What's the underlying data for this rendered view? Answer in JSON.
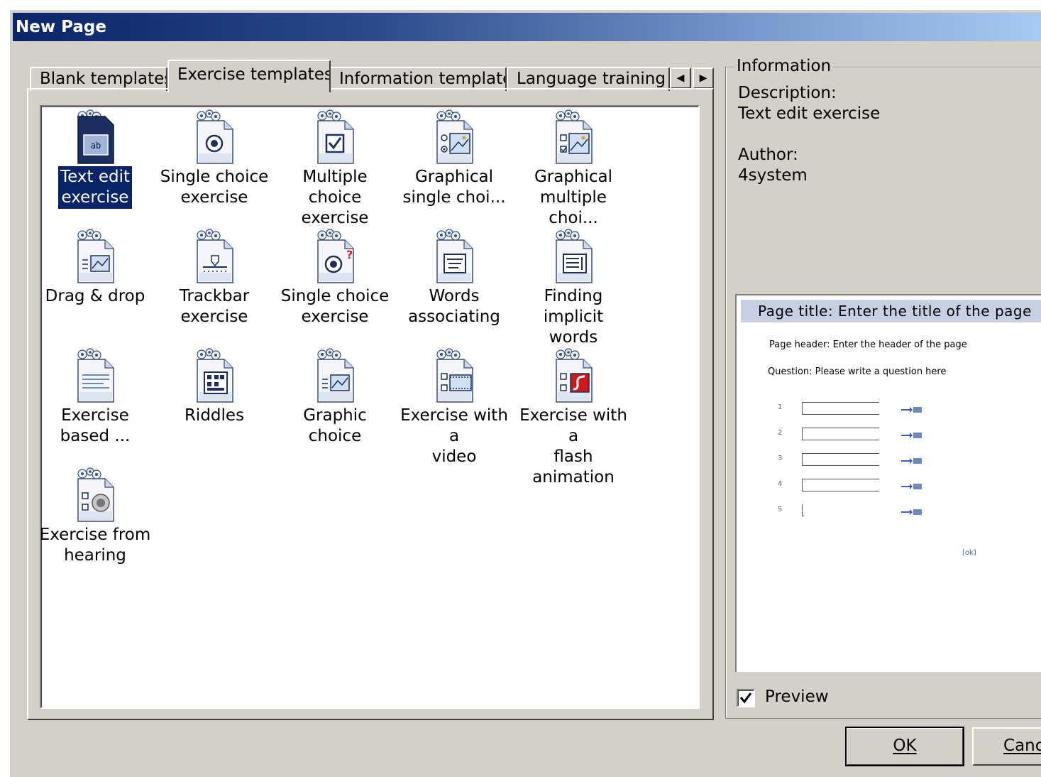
{
  "window": {
    "title": "New Page"
  },
  "tabs": [
    {
      "label": "Blank templates",
      "active": false
    },
    {
      "label": "Exercise templates",
      "active": true
    },
    {
      "label": "Information templates",
      "active": false
    },
    {
      "label": "Language training t",
      "active": false
    }
  ],
  "tab_scroll": {
    "left": "◀",
    "right": "▶"
  },
  "templates": [
    {
      "label": "Text edit\nexercise",
      "icon": "text-edit-icon",
      "selected": true
    },
    {
      "label": "Single choice\nexercise",
      "icon": "radio-icon"
    },
    {
      "label": "Multiple choice\nexercise",
      "icon": "checkbox-icon"
    },
    {
      "label": "Graphical\nsingle choi...",
      "icon": "graphical-single-icon"
    },
    {
      "label": "Graphical\nmultiple choi...",
      "icon": "graphical-multiple-icon"
    },
    {
      "label": "Drag & drop",
      "icon": "drag-drop-icon"
    },
    {
      "label": "Trackbar\nexercise",
      "icon": "trackbar-icon"
    },
    {
      "label": "Single choice\nexercise",
      "icon": "radio-question-icon"
    },
    {
      "label": "Words\nassociating",
      "icon": "words-associating-icon"
    },
    {
      "label": "Finding implicit\nwords",
      "icon": "implicit-words-icon"
    },
    {
      "label": "Exercise\nbased ...",
      "icon": "text-lines-icon"
    },
    {
      "label": "Riddles",
      "icon": "riddles-icon"
    },
    {
      "label": "Graphic\nchoice",
      "icon": "graphic-choice-icon"
    },
    {
      "label": "Exercise with a\nvideo",
      "icon": "video-icon"
    },
    {
      "label": "Exercise with a\nflash animation",
      "icon": "flash-icon"
    },
    {
      "label": "Exercise from\nhearing",
      "icon": "speaker-icon"
    }
  ],
  "info": {
    "legend": "Information",
    "description_label": "Description:",
    "description_value": "Text edit exercise",
    "author_label": "Author:",
    "author_value": "4system"
  },
  "preview": {
    "page_title": "Page title: Enter the title of the page",
    "page_header": "Page header: Enter the header of the page",
    "question": "Question: Please write a question here",
    "rows": [
      "1",
      "2",
      "3",
      "4",
      "5"
    ],
    "link": "[ok]"
  },
  "preview_checkbox": {
    "label": "Preview",
    "checked": true
  },
  "buttons": {
    "ok": "OK",
    "cancel": "Cancel"
  }
}
